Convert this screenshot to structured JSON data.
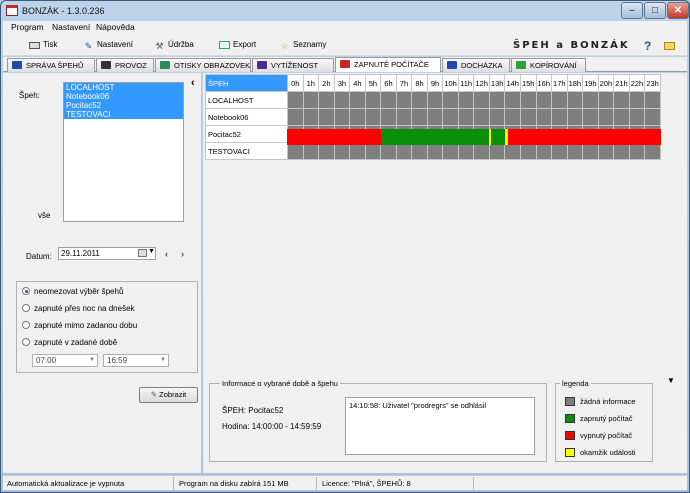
{
  "window": {
    "title": "BONZÁK - 1.3.0.236",
    "min": "–",
    "max": "□",
    "close": "✕"
  },
  "menu": [
    "Program",
    "Nastavení",
    "Nápověda"
  ],
  "toolbar": {
    "items": [
      {
        "label": "Tisk",
        "icon": "printer-icon"
      },
      {
        "label": "Nastavení",
        "icon": "settings-icon"
      },
      {
        "label": "Údržba",
        "icon": "wrench-icon"
      },
      {
        "label": "Export",
        "icon": "export-icon"
      },
      {
        "label": "Seznamy",
        "icon": "star-icon"
      }
    ],
    "brand": "ŠPEH a BONZÁK",
    "help": "?"
  },
  "tabs": [
    {
      "label": "SPRÁVA ŠPEHŮ",
      "color": "#1f4aa8"
    },
    {
      "label": "PROVOZ",
      "color": "#333333"
    },
    {
      "label": "OTISKY OBRAZOVEK",
      "color": "#2e8b57"
    },
    {
      "label": "VYTÍŽENOST",
      "color": "#4a2d8f"
    },
    {
      "label": "ZAPNUTÉ POČÍTAČE",
      "color": "#c62828"
    },
    {
      "label": "DOCHÁZKA",
      "color": "#1f4aa8"
    },
    {
      "label": "KOPÍROVÁNÍ",
      "color": "#2e9d3a"
    }
  ],
  "left": {
    "speh_label": "Špeh:",
    "speh_list": [
      "LOCALHOST",
      "Notebook06",
      "Pocitac52",
      "TESTOVACI"
    ],
    "all_label": "vše",
    "date_label": "Datum:",
    "date_value": "29.11.2011",
    "prev": "‹",
    "next": "›",
    "options": [
      "neomezovat výběr špehů",
      "zapnuté přes noc na dnešek",
      "zapnuté mimo zadanou dobu",
      "zapnuté v zadané době"
    ],
    "selected_option": 0,
    "time_from": "07:00",
    "time_to": "16:59",
    "show_button": "Zobrazit"
  },
  "grid": {
    "header": "ŠPEH",
    "hours": [
      "0h",
      "1h",
      "2h",
      "3h",
      "4h",
      "5h",
      "6h",
      "7h",
      "8h",
      "9h",
      "10h",
      "11h",
      "12h",
      "13h",
      "14h",
      "15h",
      "16h",
      "17h",
      "18h",
      "19h",
      "20h",
      "21h",
      "22h",
      "23h"
    ],
    "rows": [
      "LOCALHOST",
      "Notebook06",
      "Pocitac52",
      "TESTOVACI"
    ]
  },
  "timeline": {
    "speh": "Pocitac52",
    "segments": [
      {
        "from": 0,
        "to": 6.0,
        "state": "off"
      },
      {
        "from": 6.0,
        "to": 12.95,
        "state": "on"
      },
      {
        "from": 12.95,
        "to": 13.08,
        "state": "event"
      },
      {
        "from": 13.08,
        "to": 14.0,
        "state": "on"
      },
      {
        "from": 14.0,
        "to": 14.18,
        "state": "event"
      },
      {
        "from": 14.18,
        "to": 24,
        "state": "off"
      }
    ]
  },
  "colors": {
    "none": "#7f7f7f",
    "on": "#0a8f0a",
    "off": "#ff0000",
    "event": "#ffff00",
    "selection": "#3399ff"
  },
  "info": {
    "title": "Informace o vybrané době a špehu",
    "speh_line": "ŠPEH: Pocitac52",
    "hour_line": "Hodina: 14:00:00 - 14:59:59",
    "event": "14:10:58: Uživatel \"prodregrs\" se odhlásil"
  },
  "legend": {
    "title": "legenda",
    "items": [
      {
        "label": "žádná informace",
        "color": "#7f7f7f"
      },
      {
        "label": "zapnutý počítač",
        "color": "#0a8f0a"
      },
      {
        "label": "vypnutý počítač",
        "color": "#ff0000"
      },
      {
        "label": "okamžik události",
        "color": "#ffff00"
      }
    ]
  },
  "status": {
    "auto": "Automatická aktualizace je vypnuta",
    "disk": "Program na disku zabírá 151 MB",
    "license": "Licence: \"Plná\", ŠPEHŮ: 8"
  }
}
